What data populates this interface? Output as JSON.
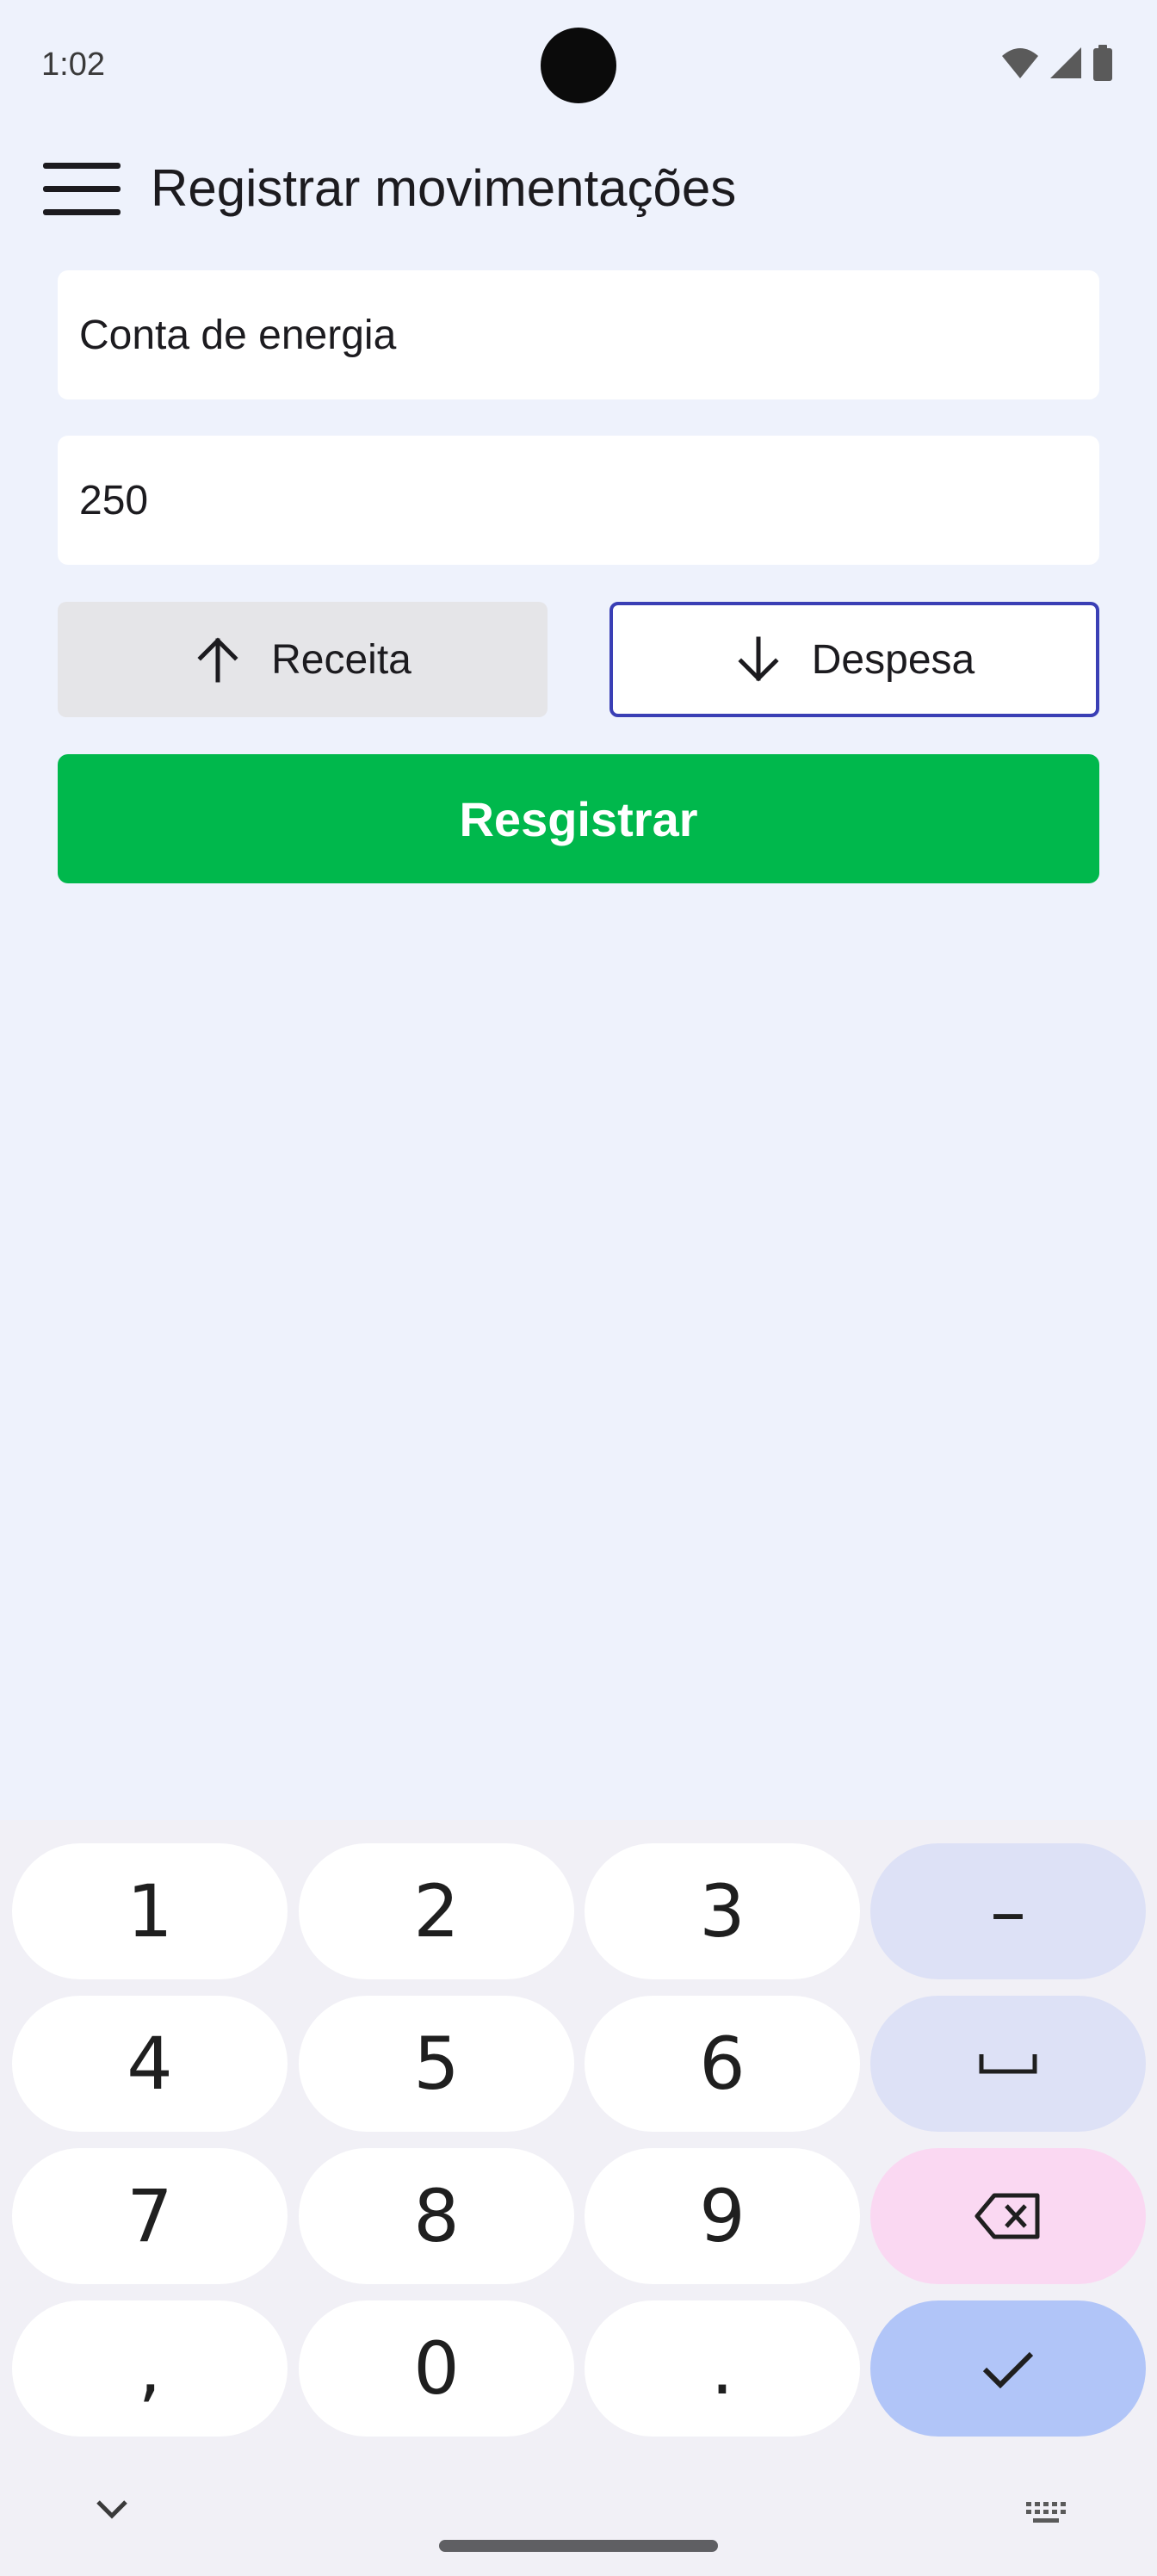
{
  "status_bar": {
    "time": "1:02"
  },
  "app_bar": {
    "title": "Registrar movimentações"
  },
  "form": {
    "description_value": "Conta de energia",
    "amount_value": "250",
    "income_label": "Receita",
    "expense_label": "Despesa",
    "register_label": "Resgistrar"
  },
  "keyboard": {
    "rows": [
      [
        "1",
        "2",
        "3",
        "–"
      ],
      [
        "4",
        "5",
        "6",
        "␣"
      ],
      [
        "7",
        "8",
        "9",
        "⌫"
      ],
      [
        ",",
        "0",
        ".",
        "✓"
      ]
    ]
  },
  "colors": {
    "background": "#EEF2FC",
    "accent_green": "#00B84C",
    "selected_border": "#3A3FB5"
  }
}
